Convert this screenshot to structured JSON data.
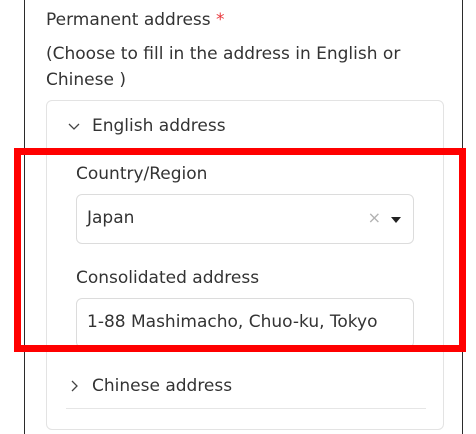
{
  "field": {
    "title": "Permanent address",
    "required_mark": "*",
    "hint": "(Choose to fill in the address in English or Chinese )"
  },
  "sections": {
    "english": {
      "title": "English address",
      "expanded": true
    },
    "chinese": {
      "title": "Chinese address",
      "expanded": false
    }
  },
  "country": {
    "label": "Country/Region",
    "value": "Japan",
    "clear_glyph": "×"
  },
  "consolidated": {
    "label": "Consolidated address",
    "value": "1-88 Mashimacho, Chuo-ku, Tokyo"
  },
  "colors": {
    "required": "#e8383d",
    "highlight": "#ff0000"
  }
}
